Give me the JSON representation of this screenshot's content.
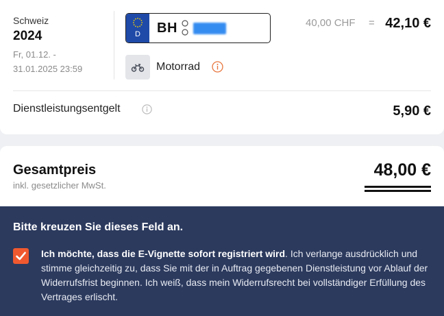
{
  "vignette": {
    "country": "Schweiz",
    "year": "2024",
    "period": "Fr, 01.12. - 31.01.2025 23:59"
  },
  "plate": {
    "country_code": "D",
    "prefix": "BH",
    "eu_color": "#1f4aa8",
    "redaction_color": "#2b86f0"
  },
  "vehicle": {
    "icon": "motorcycle-icon",
    "label": "Motorrad",
    "info_icon": "info-icon",
    "info_color": "#e8743b"
  },
  "price": {
    "base": "40,00 CHF",
    "equals": "=",
    "converted": "42,10 €"
  },
  "service_fee": {
    "label": "Dienstleistungsentgelt",
    "info_icon": "info-icon",
    "value": "5,90 €"
  },
  "total": {
    "title": "Gesamtpreis",
    "subtitle": "inkl. gesetzlicher MwSt.",
    "value": "48,00 €"
  },
  "consent": {
    "heading": "Bitte kreuzen Sie dieses Feld an.",
    "checked": true,
    "checkbox_color": "#f0592f",
    "background_color": "#2c3a5e",
    "text_bold": "Ich möchte, dass die E-Vignette sofort registriert wird",
    "text_rest": ". Ich verlange ausdrücklich und stimme gleichzeitig zu, dass Sie mit der in Auftrag gegebenen Dienstleistung vor Ablauf der Widerrufsfrist beginnen. Ich weiß, dass mein Widerrufsrecht bei vollständiger Erfüllung des Vertrages erlischt."
  }
}
